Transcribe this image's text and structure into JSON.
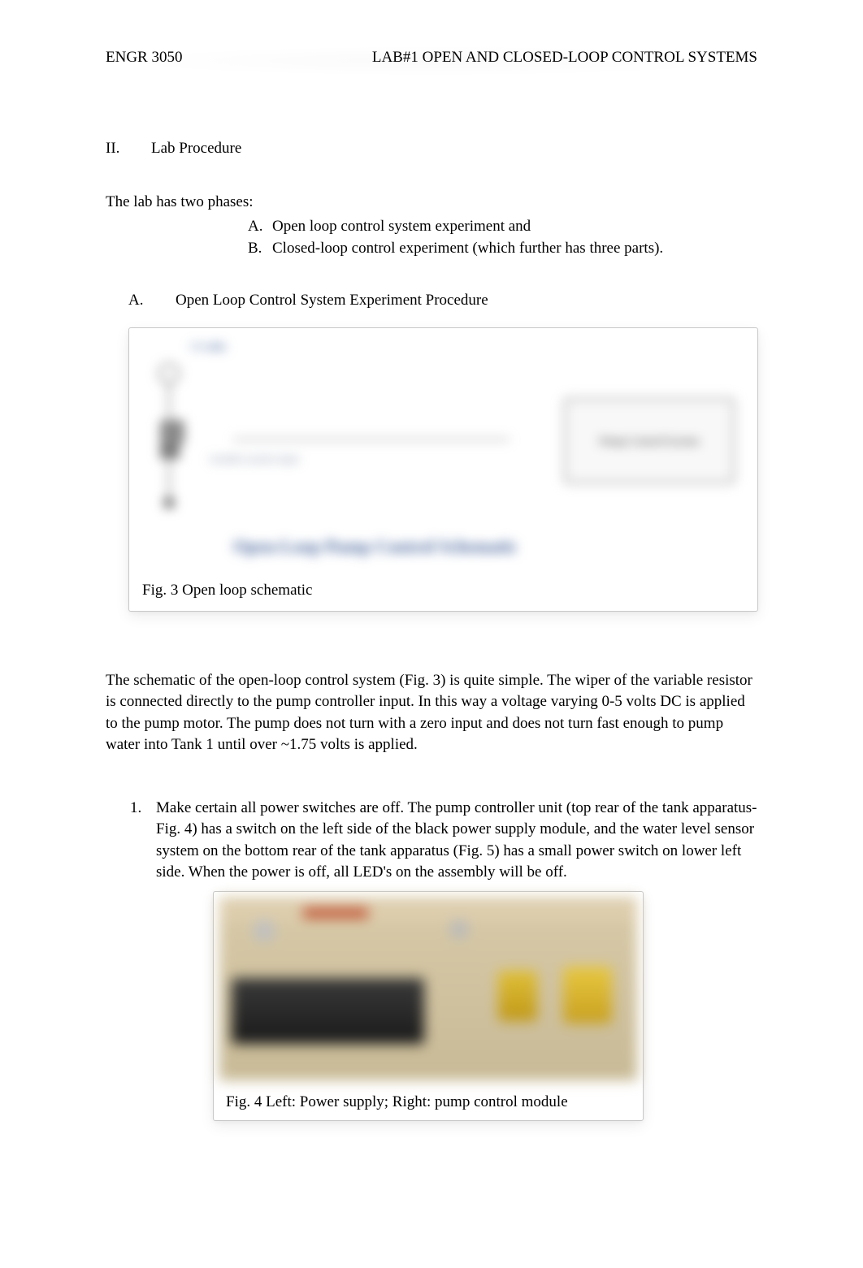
{
  "header": {
    "left": "ENGR 3050",
    "right": "LAB#1 OPEN AND CLOSED-LOOP CONTROL SYSTEMS"
  },
  "section": {
    "number": "II.",
    "title": "Lab Procedure"
  },
  "intro": "The lab has two phases:",
  "phases": [
    {
      "letter": "A.",
      "text": "Open loop control system experiment and"
    },
    {
      "letter": "B.",
      "text": "Closed-loop control experiment (which further has three parts)."
    }
  ],
  "sub_section": {
    "letter": "A.",
    "title": "Open Loop Control System Experiment Procedure"
  },
  "fig3": {
    "top_label": "+5 volts",
    "mid_text": "variable system input",
    "box_text": "Pump Control System",
    "big_title": "Open-Loop Pump Control Schematic",
    "caption": "Fig. 3 Open loop schematic"
  },
  "paragraph": "The schematic of the open-loop control system (Fig. 3) is quite simple.  The wiper of the variable resistor is connected directly to the pump controller input.   In this way a voltage varying 0-5 volts DC is applied to the pump motor.   The pump does not turn with a zero input and does not turn fast enough to pump water into Tank 1 until over ~1.75 volts is applied.",
  "steps": [
    {
      "num": "1.",
      "text": "Make certain all power switches are off.  The pump controller unit (top rear of the tank apparatus-Fig. 4) has a switch on the left side of the black power supply module, and the water level sensor system on the bottom rear of the tank apparatus (Fig. 5) has a small power switch on lower left side.  When the power is off, all LED's on the assembly will be off."
    }
  ],
  "fig4": {
    "caption_left": "Fig. 4 Left: Power supply;",
    "caption_right": "Right: pump control module"
  }
}
